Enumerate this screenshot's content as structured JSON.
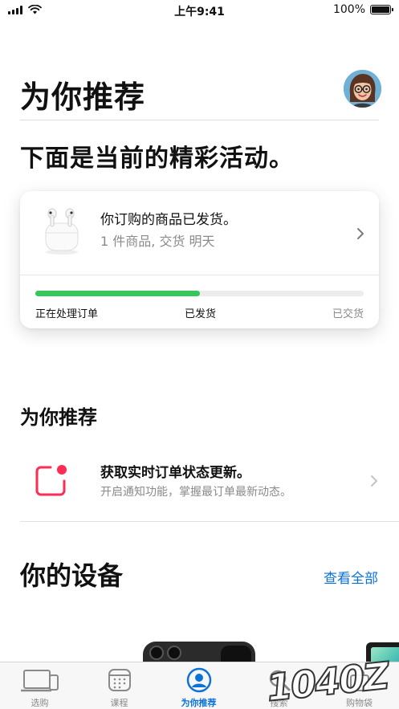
{
  "status_bar": {
    "time": "上午9:41",
    "battery": "100%"
  },
  "header": {
    "title": "为你推荐",
    "subtitle": "下面是当前的精彩活动。"
  },
  "order_card": {
    "title": "你订购的商品已发货。",
    "detail": "1 件商品, 交货 明天",
    "progress": 0.5,
    "steps": [
      "正在处理订单",
      "已发货",
      "已交货"
    ],
    "progress_color": "#35c759"
  },
  "recommend": {
    "title": "为你推荐",
    "notification_title": "获取实时订单状态更新。",
    "notification_subtitle": "开启通知功能，掌握最订单最新动态。",
    "icon_color": "#ff2d55"
  },
  "devices": {
    "title": "你的设备",
    "see_all": "查看全部"
  },
  "tabbar": {
    "items": [
      {
        "label": "选购",
        "icon": "devices-icon",
        "active": false
      },
      {
        "label": "课程",
        "icon": "calendar-icon",
        "active": false
      },
      {
        "label": "为你推荐",
        "icon": "person-icon",
        "active": true
      },
      {
        "label": "搜索",
        "icon": "search-icon",
        "active": false
      },
      {
        "label": "购物袋",
        "icon": "bag-icon",
        "active": false
      }
    ]
  },
  "watermark": "1040Z",
  "colors": {
    "accent": "#0a72d9",
    "secondary_text": "#8a8a8a"
  }
}
